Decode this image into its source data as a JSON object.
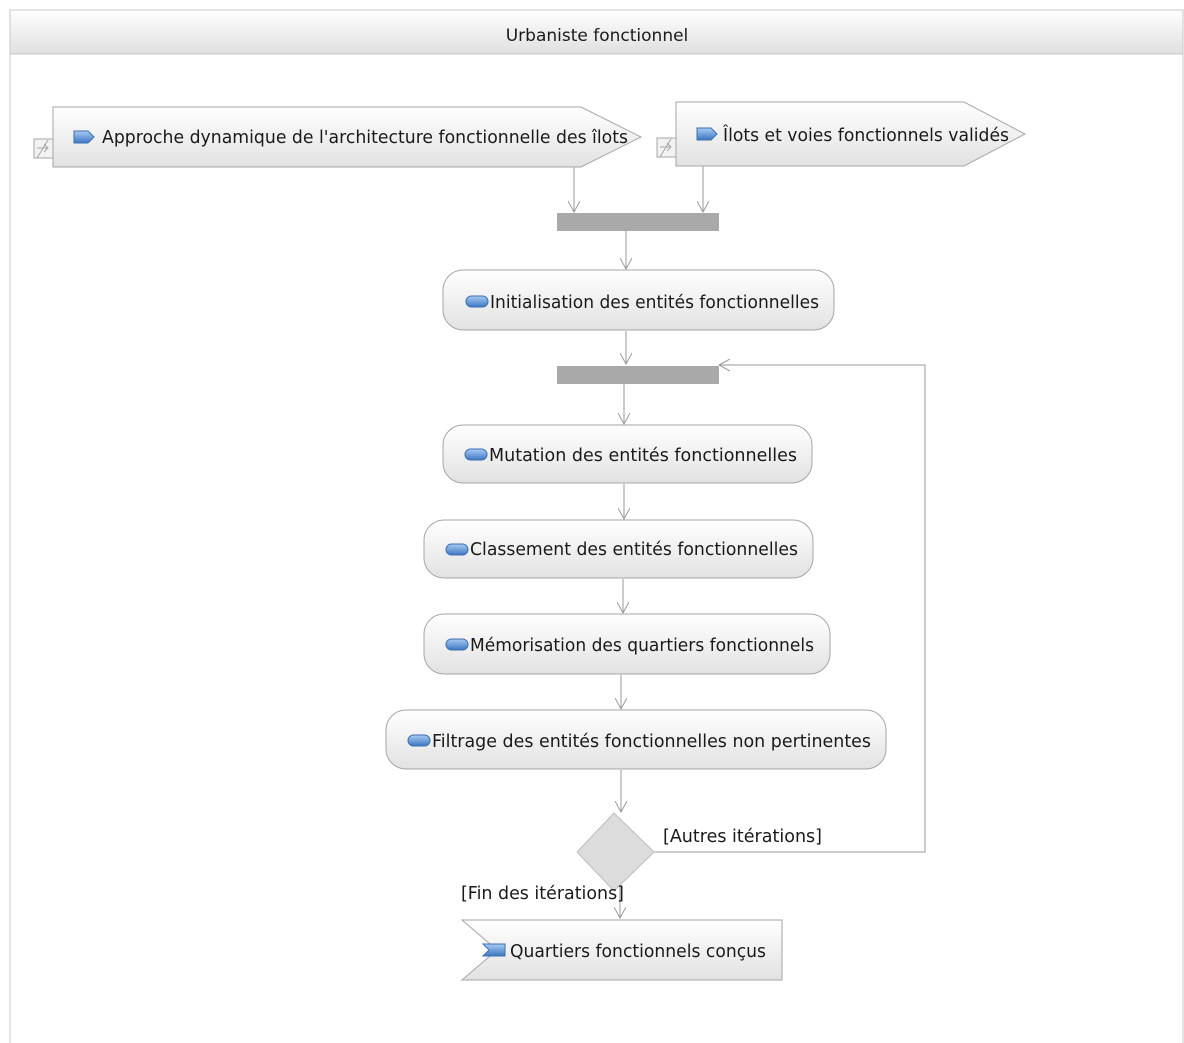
{
  "swimlane": {
    "title": "Urbaniste fonctionnel"
  },
  "inputs": [
    {
      "label": "Approche dynamique de l'architecture fonctionnelle des îlots"
    },
    {
      "label": "Îlots et voies fonctionnels validés"
    }
  ],
  "actions": [
    {
      "label": "Initialisation des entités fonctionnelles"
    },
    {
      "label": "Mutation des entités fonctionnelles"
    },
    {
      "label": "Classement des entités fonctionnelles"
    },
    {
      "label": "Mémorisation des quartiers fonctionnels"
    },
    {
      "label": "Filtrage des entités fonctionnelles non pertinentes"
    }
  ],
  "guards": {
    "loop": "[Autres itérations]",
    "exit": "[Fin des itérations]"
  },
  "output": {
    "label": "Quartiers fonctionnels conçus"
  },
  "colors": {
    "lane_header_top": "#ffffff",
    "lane_header_bottom": "#e2e2e2",
    "node_fill_top": "#ffffff",
    "node_fill_bottom": "#e3e3e3",
    "node_stroke": "#a6a6a6",
    "bar": "#a9a9a9",
    "edge": "#9a9a9a",
    "icon_blue": "#5b8fd0",
    "text": "#1a1a1a"
  }
}
